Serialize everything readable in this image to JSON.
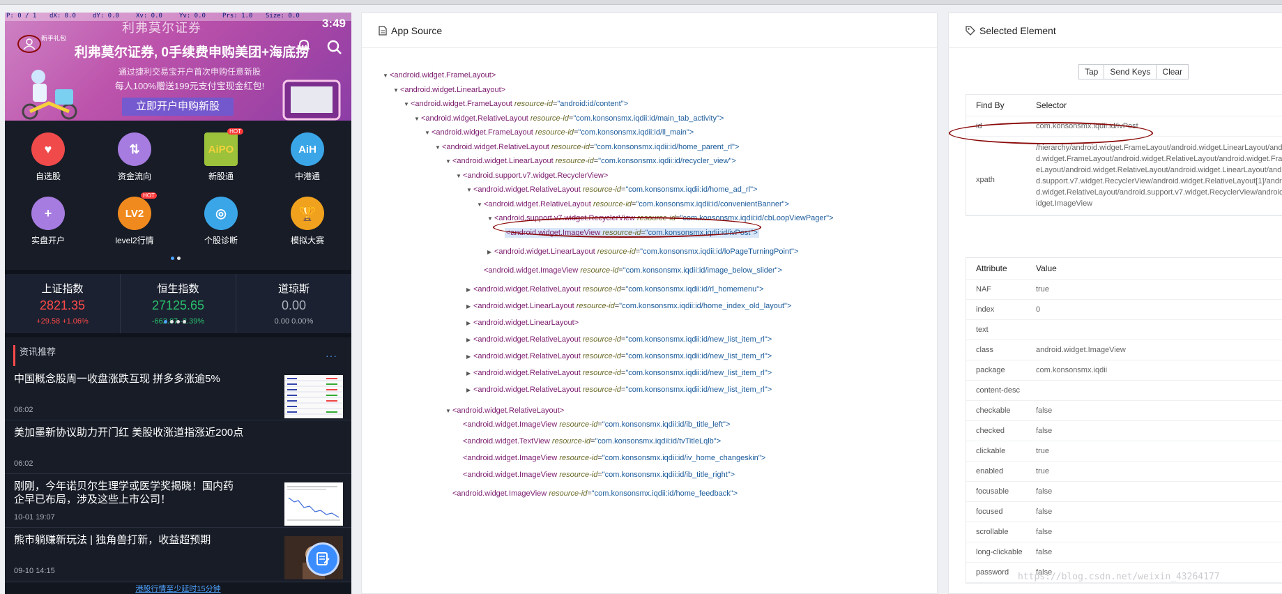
{
  "phone": {
    "devbar": [
      "P: 0 / 1",
      "dX: 0.0",
      "dY: 0.0",
      "Xv: 0.0",
      "Yv: 0.0",
      "Prs: 1.0",
      "Size: 0.0"
    ],
    "clock": "3:49",
    "app_title": "利弗莫尔证券",
    "newbie_label": "新手礼包",
    "banner": {
      "headline": "利弗莫尔证券, 0手续费申购美团+海底捞",
      "sub1": "通过捷利交易宝开户首次申购任意新股",
      "sub2": "每人100%赠送199元支付宝现金红包!",
      "cta": "立即开户申购新股"
    },
    "grid": [
      {
        "label": "自选股",
        "icon": "heart-icon",
        "color": "#f04a4a",
        "glyph": "♥"
      },
      {
        "label": "资金流向",
        "icon": "flow-icon",
        "color": "#a67ce0",
        "glyph": "⇅"
      },
      {
        "label": "新股通",
        "icon": "ipo-icon",
        "color": "#9bc23a",
        "glyph": "AiPO",
        "hot": "HOT"
      },
      {
        "label": "中港通",
        "icon": "aih-icon",
        "color": "#3aa6e8",
        "glyph": "AiH"
      },
      {
        "label": "实盘开户",
        "icon": "account-icon",
        "color": "#a67ce0",
        "glyph": "+"
      },
      {
        "label": "level2行情",
        "icon": "level2-icon",
        "color": "#f08a1e",
        "glyph": "LV2",
        "hot": "HOT"
      },
      {
        "label": "个股诊断",
        "icon": "diagnosis-icon",
        "color": "#3aa6e8",
        "glyph": "◎"
      },
      {
        "label": "模拟大赛",
        "icon": "trophy-icon",
        "color": "#f0a11e",
        "glyph": "🏆"
      }
    ],
    "indices": [
      {
        "name": "上证指数",
        "value": "2821.35",
        "change": "+29.58  +1.06%",
        "tone": "red"
      },
      {
        "name": "恒生指数",
        "value": "27125.65",
        "change": "-662.87  -2.39%",
        "tone": "green"
      },
      {
        "name": "道琼斯",
        "value": "0.00",
        "change": "0.00  0.00%",
        "tone": "grey"
      }
    ],
    "news_header": "资讯推荐",
    "news_more": "···",
    "news": [
      {
        "title": "中国概念股周一收盘涨跌互现 拼多多涨逾5%",
        "time": "06:02",
        "thumb": "table"
      },
      {
        "title": "美加墨新协议助力开门红 美股收涨道指涨近200点",
        "time": "06:02",
        "thumb": ""
      },
      {
        "title": "刚刚，今年诺贝尔生理学或医学奖揭晓！国内药企早已布局，涉及这些上市公司！",
        "time": "10-01 19:07",
        "thumb": "chart"
      },
      {
        "title": "熊市躺赚新玩法 | 独角兽打新，收益超预期",
        "time": "09-10 14:15",
        "thumb": "photo"
      }
    ],
    "footer_link": "港股行情至少延时15分钟"
  },
  "source": {
    "title": "App Source",
    "nodes": [
      {
        "indent": 0,
        "tri": "▼",
        "tag": "<android.widget.FrameLayout>",
        "attr": "",
        "val": ""
      },
      {
        "indent": 1,
        "tri": "▼",
        "tag": "<android.widget.LinearLayout>",
        "attr": "",
        "val": ""
      },
      {
        "indent": 2,
        "tri": "▼",
        "tag": "<android.widget.FrameLayout",
        "attr": "resource-id",
        "val": "\"android:id/content\">"
      },
      {
        "indent": 3,
        "tri": "▼",
        "tag": "<android.widget.RelativeLayout",
        "attr": "resource-id",
        "val": "\"com.konsonsmx.iqdii:id/main_tab_activity\">"
      },
      {
        "indent": 4,
        "tri": "▼",
        "tag": "<android.widget.FrameLayout",
        "attr": "resource-id",
        "val": "\"com.konsonsmx.iqdii:id/ll_main\">"
      },
      {
        "indent": 5,
        "tri": "▼",
        "tag": "<android.widget.RelativeLayout",
        "attr": "resource-id",
        "val": "\"com.konsonsmx.iqdii:id/home_parent_rl\">"
      },
      {
        "indent": 6,
        "tri": "▼",
        "tag": "<android.widget.LinearLayout",
        "attr": "resource-id",
        "val": "\"com.konsonsmx.iqdii:id/recycler_view\">"
      },
      {
        "indent": 7,
        "tri": "▼",
        "tag": "<android.support.v7.widget.RecyclerView>",
        "attr": "",
        "val": ""
      },
      {
        "indent": 8,
        "tri": "▼",
        "tag": "<android.widget.RelativeLayout",
        "attr": "resource-id",
        "val": "\"com.konsonsmx.iqdii:id/home_ad_rl\">"
      },
      {
        "indent": 9,
        "tri": "▼",
        "tag": "<android.widget.RelativeLayout",
        "attr": "resource-id",
        "val": "\"com.konsonsmx.iqdii:id/convenientBanner\">"
      },
      {
        "indent": 10,
        "tri": "▼",
        "tag": "<android.support.v7.widget.RecyclerView",
        "attr": "resource-id",
        "val": "\"com.konsonsmx.iqdii:id/cbLoopViewPager\">"
      },
      {
        "indent": 11,
        "tri": "",
        "tag": "<android.widget.ImageView",
        "attr": "resource-id",
        "val": "\"com.konsonsmx.iqdii:id/ivPost\">",
        "selected": true
      },
      {
        "indent": 10,
        "tri": "▶",
        "tag": "<android.widget.LinearLayout",
        "attr": "resource-id",
        "val": "\"com.konsonsmx.iqdii:id/loPageTurningPoint\">"
      },
      {
        "indent": 9,
        "tri": "",
        "tag": "<android.widget.ImageView",
        "attr": "resource-id",
        "val": "\"com.konsonsmx.iqdii:id/image_below_slider\">"
      },
      {
        "indent": 8,
        "tri": "▶",
        "tag": "<android.widget.RelativeLayout",
        "attr": "resource-id",
        "val": "\"com.konsonsmx.iqdii:id/rl_homemenu\">"
      },
      {
        "indent": 8,
        "tri": "▶",
        "tag": "<android.widget.LinearLayout",
        "attr": "resource-id",
        "val": "\"com.konsonsmx.iqdii:id/home_index_old_layout\">"
      },
      {
        "indent": 8,
        "tri": "▶",
        "tag": "<android.widget.LinearLayout>",
        "attr": "",
        "val": ""
      },
      {
        "indent": 8,
        "tri": "▶",
        "tag": "<android.widget.RelativeLayout",
        "attr": "resource-id",
        "val": "\"com.konsonsmx.iqdii:id/new_list_item_rl\">"
      },
      {
        "indent": 8,
        "tri": "▶",
        "tag": "<android.widget.RelativeLayout",
        "attr": "resource-id",
        "val": "\"com.konsonsmx.iqdii:id/new_list_item_rl\">"
      },
      {
        "indent": 8,
        "tri": "▶",
        "tag": "<android.widget.RelativeLayout",
        "attr": "resource-id",
        "val": "\"com.konsonsmx.iqdii:id/new_list_item_rl\">"
      },
      {
        "indent": 8,
        "tri": "▶",
        "tag": "<android.widget.RelativeLayout",
        "attr": "resource-id",
        "val": "\"com.konsonsmx.iqdii:id/new_list_item_rl\">"
      },
      {
        "indent": 6,
        "tri": "▼",
        "tag": "<android.widget.RelativeLayout>",
        "attr": "",
        "val": ""
      },
      {
        "indent": 7,
        "tri": "",
        "tag": "<android.widget.ImageView",
        "attr": "resource-id",
        "val": "\"com.konsonsmx.iqdii:id/ib_title_left\">"
      },
      {
        "indent": 7,
        "tri": "",
        "tag": "<android.widget.TextView",
        "attr": "resource-id",
        "val": "\"com.konsonsmx.iqdii:id/tvTitleLqlb\">"
      },
      {
        "indent": 7,
        "tri": "",
        "tag": "<android.widget.ImageView",
        "attr": "resource-id",
        "val": "\"com.konsonsmx.iqdii:id/iv_home_changeskin\">"
      },
      {
        "indent": 7,
        "tri": "",
        "tag": "<android.widget.ImageView",
        "attr": "resource-id",
        "val": "\"com.konsonsmx.iqdii:id/ib_title_right\">"
      },
      {
        "indent": 6,
        "tri": "",
        "tag": "<android.widget.ImageView",
        "attr": "resource-id",
        "val": "\"com.konsonsmx.iqdii:id/home_feedback\">"
      }
    ]
  },
  "selected": {
    "title": "Selected Element",
    "buttons": [
      "Tap",
      "Send Keys",
      "Clear"
    ],
    "find_header": [
      "Find By",
      "Selector"
    ],
    "find_rows": [
      {
        "by": "id",
        "selector": "com.konsonsmx.iqdii:id/ivPost"
      },
      {
        "by": "xpath",
        "selector": "/hierarchy/android.widget.FrameLayout/android.widget.LinearLayout/android.widget.FrameLayout/android.widget.RelativeLayout/android.widget.FrameLayout/android.widget.RelativeLayout/android.widget.LinearLayout/android.support.v7.widget.RecyclerView/android.widget.RelativeLayout[1]/android.widget.RelativeLayout/android.support.v7.widget.RecyclerView/android.widget.ImageView"
      }
    ],
    "attr_header": [
      "Attribute",
      "Value"
    ],
    "attributes": [
      {
        "k": "NAF",
        "v": "true"
      },
      {
        "k": "index",
        "v": "0"
      },
      {
        "k": "text",
        "v": ""
      },
      {
        "k": "class",
        "v": "android.widget.ImageView"
      },
      {
        "k": "package",
        "v": "com.konsonsmx.iqdii"
      },
      {
        "k": "content-desc",
        "v": ""
      },
      {
        "k": "checkable",
        "v": "false"
      },
      {
        "k": "checked",
        "v": "false"
      },
      {
        "k": "clickable",
        "v": "true"
      },
      {
        "k": "enabled",
        "v": "true"
      },
      {
        "k": "focusable",
        "v": "false"
      },
      {
        "k": "focused",
        "v": "false"
      },
      {
        "k": "scrollable",
        "v": "false"
      },
      {
        "k": "long-clickable",
        "v": "false"
      },
      {
        "k": "password",
        "v": "false"
      }
    ]
  },
  "watermark": "https://blog.csdn.net/weixin_43264177"
}
